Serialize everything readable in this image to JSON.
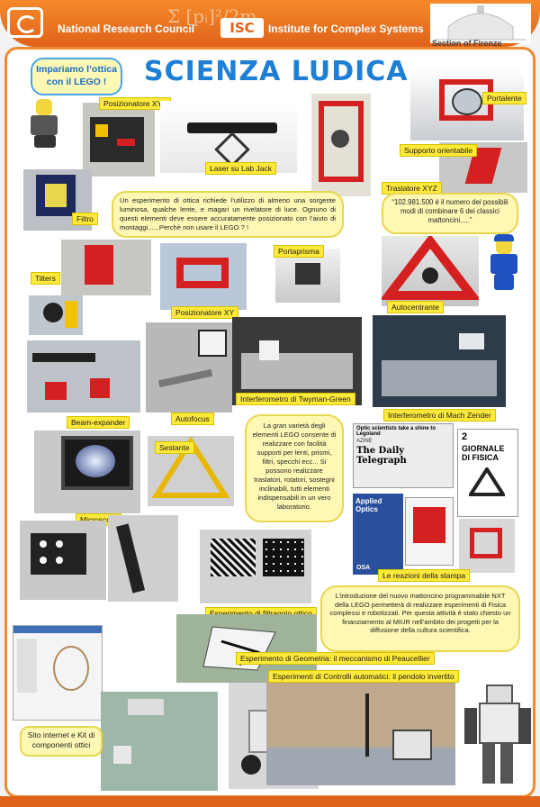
{
  "header": {
    "cnr_label": "National Research Council",
    "isc_logo": "ISC",
    "isc_label": "Institute for Complex Systems",
    "section": "Section of Firenze",
    "formula": "Σ [pᵢ]²/2m"
  },
  "title": "SCIENZA LUDICA",
  "bubbles": {
    "intro": "Impariamo l’ottica con il LEGO !",
    "description": "Un esperimento di ottica richiede l’utilizzo di almeno una sorgente luminosa, qualche lente, e magari un rivelatore di luce. Ognuno di questi elementi deve essere accuratamente posizionato con l’aiuto di montaggi......Perchè non usare il LEGO ? !",
    "combinations": "“102.981.500 è il numero dei possibili modi di combinare 6 dei classici mattoncini.....”",
    "variety": "La gran varietà degli elementi LEGO consente di realizzare con facilità supporti per lenti, prismi, filtri, specchi ecc... Si possono realizzare traslatori, rotatori, sostegni inclinabili, tutti elementi indispensabili in un vero laboratorio.",
    "nxt": "L’introduzione del nuovo mattoncino programmabile NXT della LEGO permetterà di realizzare esperimenti di Fisica complessi e robotizzati. Per questa attività è stato chiesto un finanziamento al MIUR nell’ambito dei progetti per la diffusione della cultura scientifica.",
    "website": "Sito internet e Kit di componenti ottici"
  },
  "labels": {
    "posizionatore_xyz": "Posizionatore XYZ",
    "laser": "Laser su Lab Jack",
    "portalente": "Portalente",
    "supporto": "Supporto orientabile",
    "traslatore": "Traslatore XYZ",
    "filtro": "Filtro",
    "tilters": "Tilters",
    "portaprisma": "Portaprisma",
    "posizionatore_xy": "Posizionatore XY",
    "autocentrante": "Autocentrante",
    "beam_expander": "Beam-expander",
    "autofocus": "Autofocus",
    "twyman": "Interferometro di Twyman-Green",
    "mach": "Interferometro di Mach Zender",
    "sestante": "Sestante",
    "microscopi": "Microscopi",
    "stampa": "Le reazioni della stampa",
    "filtraggio": "Esperimento di filtraggio ottico",
    "geometria": "Esperimento di Geometria: il meccanismo di Peaucellier",
    "controlli": "Esperimenti di Controlli automatici: il pendolo invertito"
  },
  "press": {
    "headline": "Optic scientists take a shine to Legoland",
    "telegraph": "The Daily Telegraph",
    "giornale": "GIORNALE DI FISICA",
    "giornale_num": "2",
    "applied_optics": "Applied Optics",
    "osa": "OSA",
    "azine": "AZINE"
  },
  "colors": {
    "orange": "#e0631a",
    "title_blue": "#1e7fd6",
    "label_yellow": "#ffe93a",
    "bubble_yellow": "#fff8b5",
    "lego_red": "#d42020"
  }
}
